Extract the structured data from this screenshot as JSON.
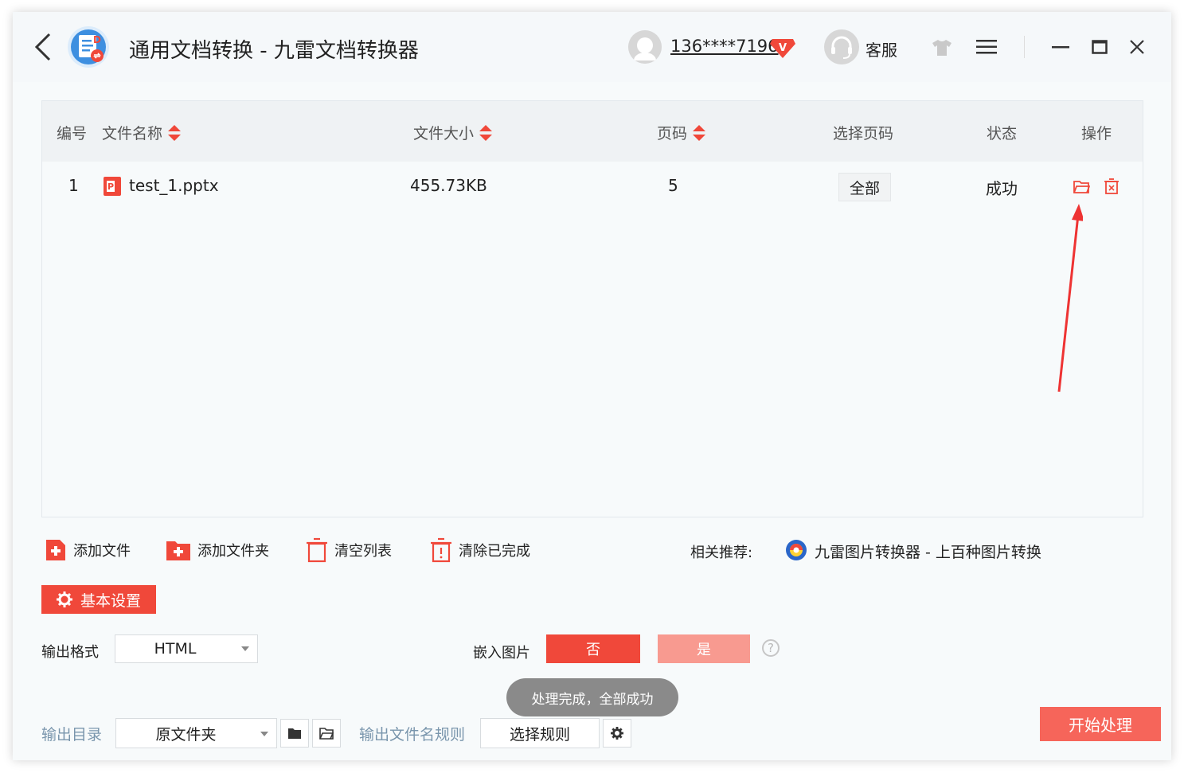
{
  "titlebar": {
    "title": "通用文档转换 - 九雷文档转换器",
    "user_phone": "136****7196",
    "vip_badge": "V",
    "customer_service": "客服",
    "icons": [
      "back-icon",
      "app-logo-icon",
      "avatar-icon",
      "vip-icon",
      "headset-icon",
      "shirt-icon",
      "menu-icon",
      "minimize-icon",
      "maximize-icon",
      "close-icon"
    ]
  },
  "table": {
    "headers": {
      "index": "编号",
      "name": "文件名称",
      "size": "文件大小",
      "pages": "页码",
      "select_pages": "选择页码",
      "status": "状态",
      "actions": "操作"
    },
    "rows": [
      {
        "index": "1",
        "name": "test_1.pptx",
        "size": "455.73KB",
        "pages": "5",
        "select_pages": "全部",
        "status": "成功"
      }
    ]
  },
  "toolbar": {
    "add_file": "添加文件",
    "add_folder": "添加文件夹",
    "clear_list": "清空列表",
    "clear_done": "清除已完成",
    "recommend_label": "相关推荐:",
    "recommend_link": "九雷图片转换器 - 上百种图片转换"
  },
  "settings": {
    "basic_settings": "基本设置",
    "output_format_label": "输出格式",
    "output_format_value": "HTML",
    "embed_images_label": "嵌入图片",
    "embed_no": "否",
    "embed_yes": "是",
    "help": "?",
    "toast": "处理完成，全部成功",
    "output_dir_label": "输出目录",
    "output_dir_value": "原文件夹",
    "filename_rule_label": "输出文件名规则",
    "filename_rule_value": "选择规则",
    "start": "开始处理"
  },
  "colors": {
    "accent": "#f0483a",
    "accent_light": "#f89a90",
    "link": "#7a96ad",
    "toast_bg": "#8a8a8a"
  }
}
